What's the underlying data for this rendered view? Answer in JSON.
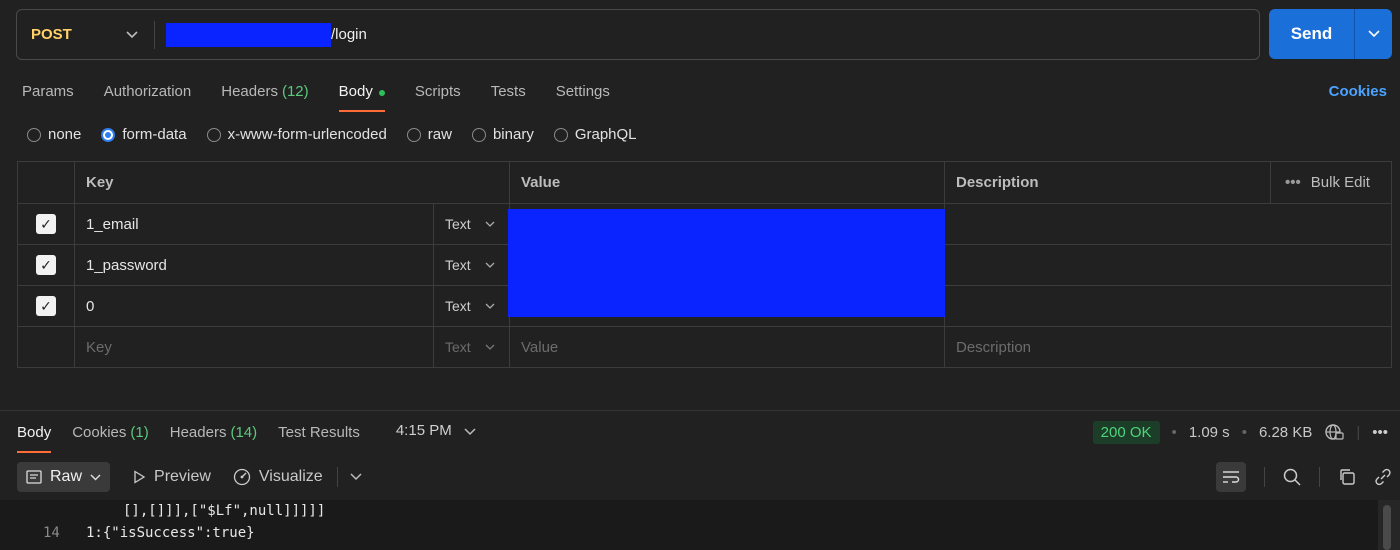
{
  "request": {
    "method": "POST",
    "url_suffix": "/login",
    "send_label": "Send"
  },
  "request_tabs": [
    {
      "label": "Params",
      "count": ""
    },
    {
      "label": "Authorization",
      "count": ""
    },
    {
      "label": "Headers",
      "count": "(12)"
    },
    {
      "label": "Body",
      "count": ""
    },
    {
      "label": "Scripts",
      "count": ""
    },
    {
      "label": "Tests",
      "count": ""
    },
    {
      "label": "Settings",
      "count": ""
    }
  ],
  "cookies_link": "Cookies",
  "body_types": [
    "none",
    "form-data",
    "x-www-form-urlencoded",
    "raw",
    "binary",
    "GraphQL"
  ],
  "body_type_selected": "form-data",
  "table": {
    "headers": {
      "key": "Key",
      "value": "Value",
      "description": "Description",
      "bulk_edit": "Bulk Edit"
    },
    "rows": [
      {
        "checked": true,
        "key": "1_email",
        "type": "Text"
      },
      {
        "checked": true,
        "key": "1_password",
        "type": "Text"
      },
      {
        "checked": true,
        "key": "0",
        "type": "Text"
      }
    ],
    "placeholder": {
      "key": "Key",
      "type": "Text",
      "value": "Value",
      "description": "Description"
    }
  },
  "response": {
    "tabs": [
      {
        "label": "Body",
        "count": ""
      },
      {
        "label": "Cookies",
        "count": "(1)"
      },
      {
        "label": "Headers",
        "count": "(14)"
      },
      {
        "label": "Test Results",
        "count": ""
      }
    ],
    "time_of_day": "4:15 PM",
    "status": "200 OK",
    "duration": "1.09 s",
    "size": "6.28 KB",
    "view_mode": "Raw",
    "preview_label": "Preview",
    "visualize_label": "Visualize",
    "code_lines": [
      {
        "num": "",
        "text": "[],[]]],[\"$Lf\",null]]]]]"
      },
      {
        "num": "14",
        "text": "1:{\"isSuccess\":true}"
      }
    ]
  },
  "colors": {
    "accent_orange": "#ff6c37",
    "send_blue": "#1b6fd8",
    "status_green": "#4fd47c",
    "method_yellow": "#ffd166",
    "link_blue": "#4aa3ff"
  }
}
